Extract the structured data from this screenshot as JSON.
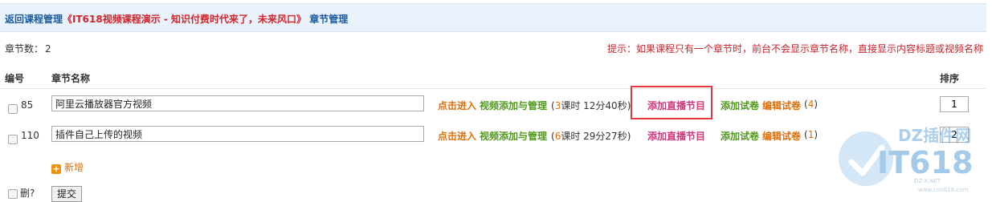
{
  "header": {
    "back_label": "返回课程管理",
    "course_title": "《IT618视频课程演示 - 知识付费时代来了，未来风口》",
    "chapter_label": "章节管理"
  },
  "summary": {
    "count_label": "章节数：",
    "count_value": "2"
  },
  "tip": "提示：如果课程只有一个章节时，前台不会显示章节名称，直接显示内容标题或视频名称",
  "table": {
    "headers": {
      "id": "编号",
      "name": "章节名称",
      "sort": "排序"
    },
    "rows": [
      {
        "id": "85",
        "name": "阿里云播放器官方视频",
        "enter": "点击进入",
        "manage": "视频添加与管理",
        "stat_prefix": "(",
        "lessons": "3",
        "lessons_unit": "课时 ",
        "duration": "12分40秒",
        "stat_suffix": ")",
        "live": "添加直播节目",
        "add_trial": "添加试卷",
        "edit_trial": "编辑试卷",
        "edit_prefix": "(",
        "edit_count": "4",
        "edit_suffix": ")",
        "sort": "1"
      },
      {
        "id": "110",
        "name": "插件自己上传的视频",
        "enter": "点击进入",
        "manage": "视频添加与管理",
        "stat_prefix": "(",
        "lessons": "6",
        "lessons_unit": "课时 ",
        "duration": "29分27秒",
        "stat_suffix": ")",
        "live": "添加直播节目",
        "add_trial": "添加试卷",
        "edit_trial": "编辑试卷",
        "edit_prefix": "(",
        "edit_count": "1",
        "edit_suffix": ")",
        "sort": "2"
      }
    ]
  },
  "add_new_label": "新增",
  "footer": {
    "delete_label": "删?",
    "submit_label": "提交"
  },
  "watermark": {
    "brand": "DZ插件网",
    "logo_text": "IT618",
    "url": "DZ-X.NET",
    "sub_url": "www.cnit618.com"
  },
  "colors": {
    "accent_red": "#d0252a",
    "link_blue": "#1b5c9e",
    "orange": "#e06f0a",
    "green": "#4f9a1a",
    "pink": "#d0377d"
  }
}
